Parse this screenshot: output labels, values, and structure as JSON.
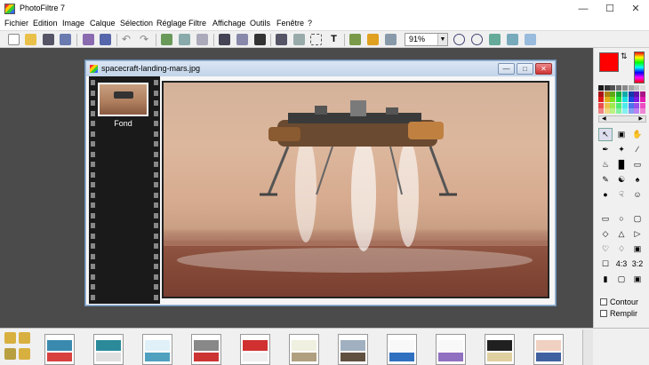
{
  "window": {
    "title": "PhotoFiltre 7"
  },
  "menu": [
    "Fichier",
    "Edition",
    "Image",
    "Calque",
    "Sélection",
    "Réglage",
    "Filtre",
    "Affichage",
    "Outils",
    "Fenêtre",
    "?"
  ],
  "toolbar": {
    "zoom_value": "91%"
  },
  "document": {
    "title": "spacecraft-landing-mars.jpg"
  },
  "layers": [
    {
      "label": "Fond"
    }
  ],
  "colors": {
    "foreground": "#ff0000",
    "background": "#ffffff",
    "accent": "#6b8fb5"
  },
  "options": {
    "contour_label": "Contour",
    "remplir_label": "Remplir"
  },
  "icons": {
    "title": [
      "app-logo-icon",
      "minimize-icon",
      "maximize-icon",
      "close-icon"
    ],
    "toolbar": [
      "new-icon",
      "open-icon",
      "save-icon",
      "save-as-icon",
      "print-icon",
      "scan-icon",
      "undo-icon",
      "redo-icon",
      "paste-icon",
      "copy-icon",
      "crop-icon",
      "resize-icon",
      "canvas-icon",
      "adjust-icon",
      "flip-icon",
      "select-icon",
      "text-icon",
      "transform-icon",
      "stamp-icon",
      "layer-icon",
      "zoom-in-icon",
      "zoom-out-icon",
      "fit-icon",
      "actual-size-icon",
      "fullscreen-icon"
    ],
    "tools": [
      "pointer-icon",
      "select-move-icon",
      "hand-icon",
      "eyedropper-icon",
      "magic-wand-icon",
      "line-icon",
      "fill-icon",
      "spray-icon",
      "eraser-icon",
      "brush-icon",
      "smudge-icon",
      "clone-icon",
      "blur-icon",
      "finger-icon",
      "portrait-icon"
    ],
    "shapes": [
      "rectangle-icon",
      "ellipse-icon",
      "rounded-rect-icon",
      "diamond-icon",
      "triangle-icon",
      "arrow-right-icon",
      "lasso-icon",
      "polygon-lasso-icon",
      "folder-open-icon",
      "frame-icon",
      "ratio-4-3-icon",
      "ratio-3-2-icon",
      "bar-icon",
      "crop-frame-icon",
      "window-icon"
    ],
    "bottom_nav": [
      "folder-up-icon",
      "folder-icon",
      "folder-back-icon",
      "folder-down-icon"
    ]
  }
}
